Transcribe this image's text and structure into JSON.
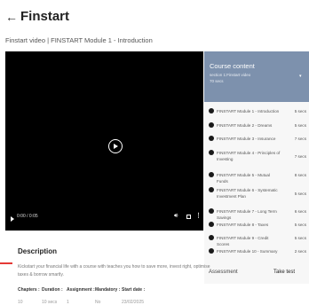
{
  "header": {
    "back_icon": "arrow-left-icon",
    "title": "Finstart"
  },
  "subtitle": "Finstart video | FINSTART Module 1 - Introduction",
  "video": {
    "time": "0:00 / 0:05"
  },
  "course_content": {
    "title": "Course content",
    "section": "section 1:Finstart video",
    "duration": "70 secs",
    "items": [
      {
        "label": "FINSTART Module 1 - Introduction",
        "duration": "5 secs"
      },
      {
        "label": "FINSTART Module 2 - Dreams",
        "duration": "5 secs"
      },
      {
        "label": "FINSTART Module 3 - Insurance",
        "duration": "7 secs"
      },
      {
        "label": "FINSTART Module 4 - Principles of Investing",
        "duration": "7 secs"
      },
      {
        "label": "FINSTART Module 5 - Mutual Funds",
        "duration": "8 secs"
      },
      {
        "label": "FINSTART Module 6 - Systematic Investment Plan",
        "duration": "5 secs"
      },
      {
        "label": "FINSTART Module 7 - Long Term Savings",
        "duration": "6 secs"
      },
      {
        "label": "FINSTART Module 8 - Taxes",
        "duration": "5 secs"
      },
      {
        "label": "FINSTART Module 9 - Credit Scores",
        "duration": "5 secs"
      },
      {
        "label": "FINSTART Module 10 - Summary",
        "duration": "2 secs"
      }
    ]
  },
  "assessment": {
    "label": "Assessment",
    "action": "Take test"
  },
  "description": {
    "heading": "Description",
    "text": "Kickstart your financial life with a course with teaches you how to save more, invest right, optimise taxes & borrow smartly."
  },
  "meta": {
    "labels": [
      "Chapters :",
      "Duration :",
      "Assignment :",
      "Mandatory :",
      "Start date :"
    ],
    "values": [
      "10",
      "10 secs",
      "1",
      "No",
      "23/02/2025"
    ]
  },
  "colors": {
    "panel_header": "#7d91ad",
    "accent_line": "#e53935"
  }
}
